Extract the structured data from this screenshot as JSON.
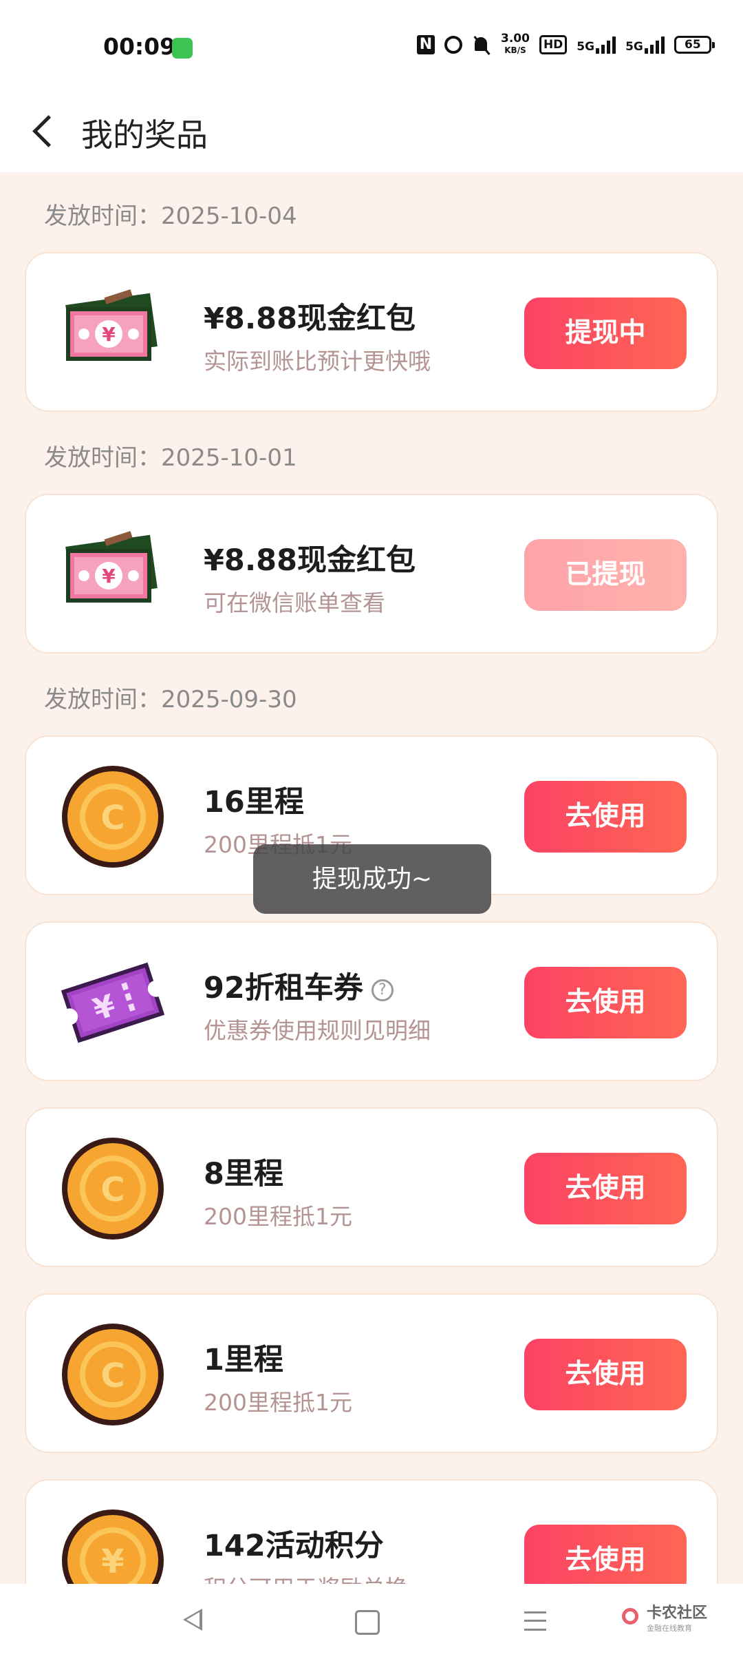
{
  "status_bar": {
    "time": "00:09",
    "net_speed_value": "3.00",
    "net_speed_unit": "KB/S",
    "hd_label": "HD",
    "sim1_label": "5G",
    "sim2_label": "5G",
    "battery": "65"
  },
  "header": {
    "title": "我的奖品"
  },
  "sections": [
    {
      "date": "发放时间：2025-10-04"
    },
    {
      "date": "发放时间：2025-10-01"
    },
    {
      "date": "发放时间：2025-09-30"
    }
  ],
  "prizes": [
    {
      "icon": "cash-envelope-icon",
      "title": "¥8.88现金红包",
      "subtitle": "实际到账比预计更快哦",
      "button": "提现中",
      "button_state": "active"
    },
    {
      "icon": "cash-envelope-icon",
      "title": "¥8.88现金红包",
      "subtitle": "可在微信账单查看",
      "button": "已提现",
      "button_state": "disabled"
    },
    {
      "icon": "coin-c-icon",
      "title": "16里程",
      "subtitle": "200里程抵1元",
      "button": "去使用",
      "button_state": "active"
    },
    {
      "icon": "rental-coupon-icon",
      "title": "92折租车券",
      "subtitle": "优惠券使用规则见明细",
      "button": "去使用",
      "button_state": "active",
      "help": "?"
    },
    {
      "icon": "coin-c-icon",
      "title": "8里程",
      "subtitle": "200里程抵1元",
      "button": "去使用",
      "button_state": "active"
    },
    {
      "icon": "coin-c-icon",
      "title": "1里程",
      "subtitle": "200里程抵1元",
      "button": "去使用",
      "button_state": "active"
    },
    {
      "icon": "coin-yen-icon",
      "title": "142活动积分",
      "subtitle": "积分可用于奖励兑换",
      "button": "去使用",
      "button_state": "active"
    }
  ],
  "toast": {
    "text": "提现成功~"
  },
  "watermark": {
    "name": "卡农社区",
    "tagline": "金融在线教育"
  }
}
